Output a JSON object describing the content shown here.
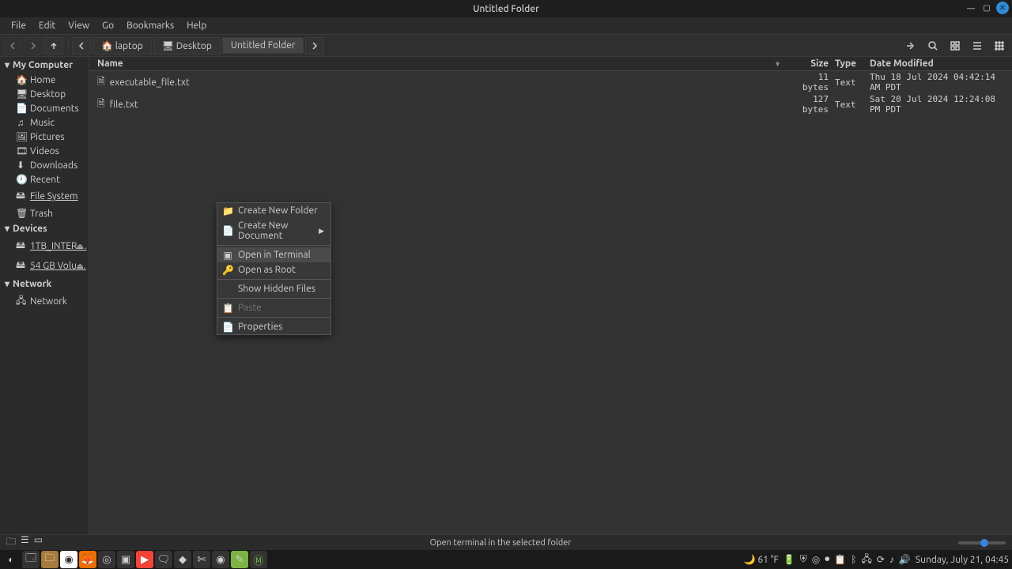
{
  "window": {
    "title": "Untitled Folder"
  },
  "menu": [
    "File",
    "Edit",
    "View",
    "Go",
    "Bookmarks",
    "Help"
  ],
  "breadcrumbs": [
    {
      "label": "laptop"
    },
    {
      "label": "Desktop"
    },
    {
      "label": "Untitled Folder",
      "active": true
    }
  ],
  "sidebar": {
    "sections": [
      {
        "title": "My Computer",
        "items": [
          {
            "icon": "🏠",
            "label": "Home"
          },
          {
            "icon": "🖥",
            "label": "Desktop"
          },
          {
            "icon": "📄",
            "label": "Documents"
          },
          {
            "icon": "♫",
            "label": "Music"
          },
          {
            "icon": "🖼",
            "label": "Pictures"
          },
          {
            "icon": "🎞",
            "label": "Videos"
          },
          {
            "icon": "⬇",
            "label": "Downloads"
          },
          {
            "icon": "🕘",
            "label": "Recent"
          },
          {
            "icon": "🖴",
            "label": "File System",
            "underline": true
          },
          {
            "icon": "🗑",
            "label": "Trash"
          }
        ]
      },
      {
        "title": "Devices",
        "items": [
          {
            "icon": "🖴",
            "label": "1TB_INTER…",
            "eject": true,
            "underline": true
          },
          {
            "icon": "🖴",
            "label": "54 GB Volu…",
            "eject": true,
            "underline": true
          }
        ]
      },
      {
        "title": "Network",
        "items": [
          {
            "icon": "🖧",
            "label": "Network"
          }
        ]
      }
    ]
  },
  "columns": {
    "name": "Name",
    "size": "Size",
    "type": "Type",
    "date": "Date Modified"
  },
  "files": [
    {
      "name": "executable_file.txt",
      "size": "11 bytes",
      "type": "Text",
      "date": "Thu 18 Jul 2024 04:42:14 AM PDT"
    },
    {
      "name": "file.txt",
      "size": "127 bytes",
      "type": "Text",
      "date": "Sat 20 Jul 2024 12:24:08 PM PDT"
    }
  ],
  "context_menu": {
    "items": [
      {
        "icon": "📁",
        "label": "Create New Folder"
      },
      {
        "icon": "📄",
        "label": "Create New Document",
        "submenu": true
      },
      {
        "sep": true
      },
      {
        "icon": "▣",
        "label": "Open in Terminal",
        "hover": true
      },
      {
        "icon": "🔑",
        "label": "Open as Root"
      },
      {
        "sep": true
      },
      {
        "icon": "",
        "label": "Show Hidden Files"
      },
      {
        "sep": true
      },
      {
        "icon": "📋",
        "label": "Paste",
        "disabled": true
      },
      {
        "sep": true
      },
      {
        "icon": "📄",
        "label": "Properties"
      }
    ]
  },
  "status": {
    "message": "Open terminal in the selected folder"
  },
  "taskbar": {
    "weather": "🌙 61 °F",
    "clock": "Sunday, July 21, 04:45"
  }
}
